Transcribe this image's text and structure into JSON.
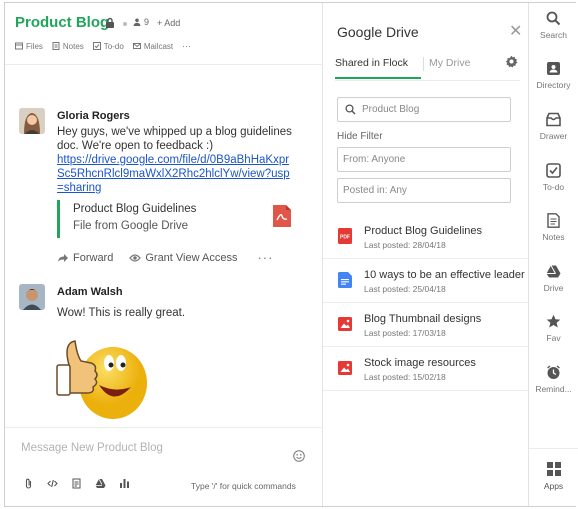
{
  "channel": {
    "title": "Product Blog",
    "member_count": "9",
    "add_label": "+ Add",
    "subnav": [
      {
        "label": "Files",
        "icon": "files-icon"
      },
      {
        "label": "Notes",
        "icon": "notes-icon"
      },
      {
        "label": "To-do",
        "icon": "todo-icon"
      },
      {
        "label": "Mailcast",
        "icon": "mailcast-icon"
      }
    ],
    "subnav_more": "···"
  },
  "messages": [
    {
      "author": "Gloria Rogers",
      "text": "Hey guys, we've whipped up a blog guidelines doc. We're open to feedback :)",
      "link": "https://drive.google.com/file/d/0B9aBhHaKxprSc5RhcnRlcl9maWxlX2Rhc2hlclYw/view?usp=sharing",
      "attachment": {
        "title": "Product Blog Guidelines",
        "subtitle": "File from Google Drive"
      },
      "actions": {
        "forward": "Forward",
        "grant": "Grant View Access",
        "more": "···"
      }
    },
    {
      "author": "Adam Walsh",
      "text": "Wow! This is really great."
    }
  ],
  "composer": {
    "placeholder": "Message New Product Blog",
    "hint": "Type '/' for quick commands"
  },
  "drive": {
    "title": "Google Drive",
    "tabs": [
      "Shared in Flock",
      "My Drive"
    ],
    "search_placeholder": "Product Blog",
    "hide_filter": "Hide Filter",
    "from_placeholder": "From: Anyone",
    "posted_placeholder": "Posted in: Any",
    "files": [
      {
        "name": "Product Blog Guidelines",
        "date": "Last posted: 28/04/18",
        "type": "pdf",
        "color": "#e53935"
      },
      {
        "name": "10 ways to be an effective leader",
        "date": "Last posted: 25/04/18",
        "type": "doc",
        "color": "#4285f4"
      },
      {
        "name": "Blog Thumbnail designs",
        "date": "Last posted: 17/03/18",
        "type": "image",
        "color": "#e53935"
      },
      {
        "name": "Stock image resources",
        "date": "Last posted: 15/02/18",
        "type": "image",
        "color": "#e53935"
      }
    ]
  },
  "rail": [
    {
      "label": "Search",
      "icon": "search-icon"
    },
    {
      "label": "Directory",
      "icon": "directory-icon"
    },
    {
      "label": "Drawer",
      "icon": "drawer-icon"
    },
    {
      "label": "To-do",
      "icon": "todo-icon"
    },
    {
      "label": "Notes",
      "icon": "notes-icon"
    },
    {
      "label": "Drive",
      "icon": "drive-icon"
    },
    {
      "label": "Fav",
      "icon": "star-icon"
    },
    {
      "label": "Remind...",
      "icon": "clock-icon"
    },
    {
      "label": "Apps",
      "icon": "apps-icon"
    }
  ],
  "colors": {
    "accent": "#21a55b",
    "link": "#1a55c9"
  }
}
